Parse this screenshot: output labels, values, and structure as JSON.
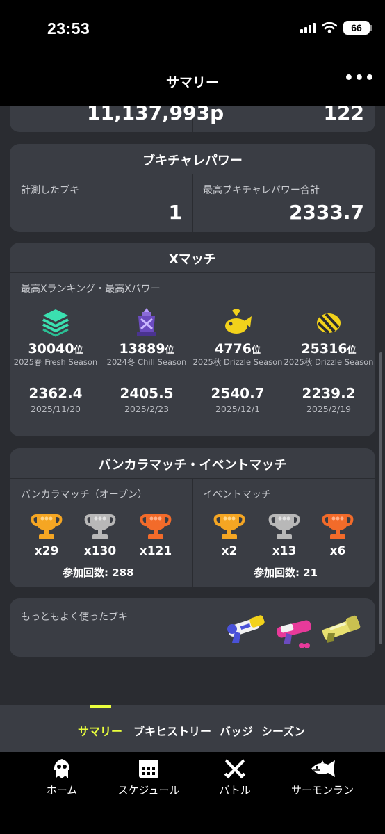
{
  "status": {
    "time": "23:53",
    "battery": "66"
  },
  "header": {
    "title": "サマリー",
    "more": "•••"
  },
  "top_card": {
    "left_value": "11,137,993p",
    "right_value": "122"
  },
  "buki_power": {
    "title": "ブキチャレパワー",
    "measured_label": "計測したブキ",
    "measured_value": "1",
    "max_label": "最高ブキチャレパワー合計",
    "max_value": "2333.7"
  },
  "xmatch": {
    "title": "Xマッチ",
    "subtitle": "最高Xランキング・最高Xパワー",
    "columns": [
      {
        "icon": "splat-zones-icon",
        "rank": "30040",
        "rank_suffix": "位",
        "season": "2025春 Fresh Season",
        "power": "2362.4",
        "date": "2025/11/20"
      },
      {
        "icon": "tower-control-icon",
        "rank": "13889",
        "rank_suffix": "位",
        "season": "2024冬 Chill Season",
        "power": "2405.5",
        "date": "2025/2/23"
      },
      {
        "icon": "rainmaker-icon",
        "rank": "4776",
        "rank_suffix": "位",
        "season": "2025秋 Drizzle Season",
        "power": "2540.7",
        "date": "2025/12/1"
      },
      {
        "icon": "clam-blitz-icon",
        "rank": "25316",
        "rank_suffix": "位",
        "season": "2025秋 Drizzle Season",
        "power": "2239.2",
        "date": "2025/2/19"
      }
    ]
  },
  "bankara": {
    "title": "バンカラマッチ・イベントマッチ",
    "open_label": "バンカラマッチ（オープン）",
    "open_trophies": [
      "x29",
      "x130",
      "x121"
    ],
    "open_participation": "参加回数: 288",
    "event_label": "イベントマッチ",
    "event_trophies": [
      "x2",
      "x13",
      "x6"
    ],
    "event_participation": "参加回数: 21",
    "trophy_colors": [
      "#f5a623",
      "#b8b8b8",
      "#f26b2a"
    ]
  },
  "most_used": {
    "label": "もっともよく使ったブキ"
  },
  "tabs": [
    {
      "label": "サマリー",
      "active": true
    },
    {
      "label": "ブキヒストリー"
    },
    {
      "label": "バッジ"
    },
    {
      "label": "シーズン"
    }
  ],
  "nav": [
    {
      "label": "ホーム",
      "icon": "squid-icon"
    },
    {
      "label": "スケジュール",
      "icon": "calendar-icon"
    },
    {
      "label": "バトル",
      "icon": "crossed-swords-icon"
    },
    {
      "label": "サーモンラン",
      "icon": "salmon-icon"
    }
  ],
  "colors": {
    "accent": "#eaff3d",
    "card": "#3a3d44",
    "background": "#2a2c31"
  }
}
